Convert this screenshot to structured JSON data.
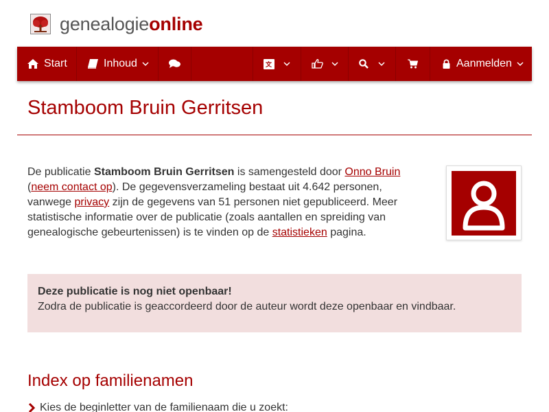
{
  "brand": {
    "name_part1": "genealogie",
    "name_part2": "online",
    "logo_icon": "tree-icon",
    "accent_color": "#a50000"
  },
  "nav": {
    "start_label": "Start",
    "inhoud_label": "Inhoud",
    "aanmelden_label": "Aanmelden",
    "icons": [
      "home-icon",
      "book-icon",
      "comments-icon",
      "language-icon",
      "thumbs-up-icon",
      "search-icon",
      "cart-icon",
      "lock-icon"
    ]
  },
  "page": {
    "title": "Stamboom Bruin Gerritsen"
  },
  "intro": {
    "t1": "De publicatie ",
    "pub_name": "Stamboom Bruin Gerritsen",
    "t2": " is samengesteld door ",
    "author_link": "Onno Bruin",
    "t3": " (",
    "contact_link": "neem contact op",
    "t4": "). De gegevensverzameling bestaat uit 4.642 personen, vanwege ",
    "privacy_link": "privacy",
    "t5": " zijn de gegevens van 51 personen niet gepubliceerd. Meer statistische informatie over de publicatie (zoals aantallen en spreiding van genealogische gebeurtenissen) is te vinden op de ",
    "stats_link": "statistieken",
    "t6": " pagina."
  },
  "notice": {
    "heading": "Deze publicatie is nog niet openbaar!",
    "body": "Zodra de publicatie is geaccordeerd door de auteur wordt deze openbaar en vindbaar."
  },
  "index": {
    "title": "Index op familienamen",
    "instruction": "Kies de beginletter van de familienaam die u zoekt:"
  }
}
